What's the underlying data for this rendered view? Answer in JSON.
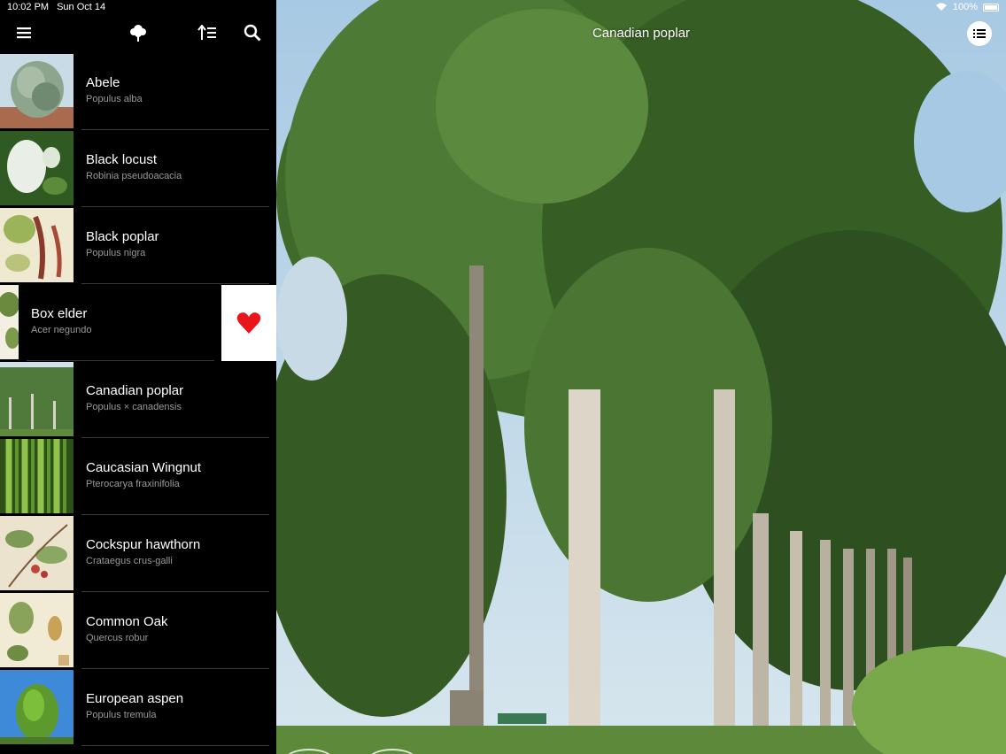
{
  "status": {
    "time": "10:02 PM",
    "date": "Sun Oct 14",
    "battery": "100%"
  },
  "toolbar": {
    "menu_icon": "hamburger-menu-icon",
    "tree_icon": "tree-icon",
    "sort_icon": "sort-icon",
    "search_icon": "search-icon"
  },
  "trees": [
    {
      "name": "Abele",
      "scientific": "Populus alba"
    },
    {
      "name": "Black locust",
      "scientific": "Robinia pseudoacacia"
    },
    {
      "name": "Black poplar",
      "scientific": "Populus nigra"
    },
    {
      "name": "Box elder",
      "scientific": "Acer negundo"
    },
    {
      "name": "Canadian poplar",
      "scientific": "Populus × canadensis"
    },
    {
      "name": "Caucasian Wingnut",
      "scientific": "Pterocarya fraxinifolia"
    },
    {
      "name": "Cockspur hawthorn",
      "scientific": "Crataegus crus-galli"
    },
    {
      "name": "Common Oak",
      "scientific": "Quercus robur"
    },
    {
      "name": "European aspen",
      "scientific": "Populus tremula"
    }
  ],
  "detail": {
    "title": "Canadian poplar"
  },
  "colors": {
    "favorite": "#e8151b",
    "background": "#000000",
    "sky": "#b9d5ea",
    "foliage": "#3f6a2a"
  }
}
